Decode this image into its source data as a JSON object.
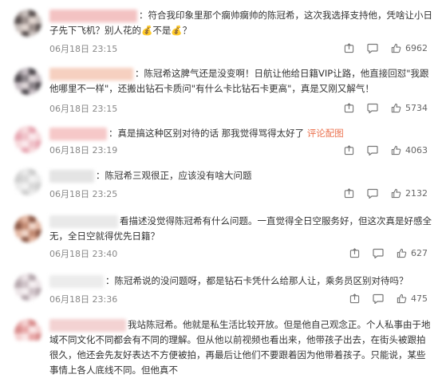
{
  "comments": [
    {
      "avatar_colors": [
        "#9b8f8c",
        "#c7bebb",
        "#5a5150",
        "#e2d6d0"
      ],
      "name_color": "#f3c2c2",
      "text": "：符合我印象里那个瘸帅瘸帅的陈冠希，这次我选择支持他，凭啥让小日子先下飞机？别人花的💰不是💰？",
      "date": "06月18日 23:15",
      "likes": "6962"
    },
    {
      "avatar_colors": [
        "#8a8388",
        "#c5bcc2",
        "#4f4a4f",
        "#ddd5d8"
      ],
      "name_color": "#f6d0c0",
      "text": "：陈冠希这脾气还是没变啊！日航让他给日籍VIP让路，他直接回怼\"我跟他哪里不一样\"，还搬出钻石卡质问\"有什么卡比钻石卡更高\"，真是又刚又解气！",
      "date": "06月18日 23:15",
      "likes": "5734"
    },
    {
      "avatar_colors": [
        "#f0c2c9",
        "#f7dadd",
        "#e8a9b4",
        "#fbe9ec"
      ],
      "name_color": "#f6c8c8",
      "text": "：真是搞这种区别对待的话 那我觉得骂得太好了",
      "link": "评论配图",
      "date": "06月18日 23:19",
      "likes": "4063"
    },
    {
      "avatar_colors": [
        "#d9d9d9",
        "#eaeaea",
        "#cfcfcf",
        "#f2f2f2"
      ],
      "name_color": "#e4e4e4",
      "text": "：陈冠希三观很正，应该没有啥大问题",
      "date": "06月18日 23:25",
      "likes": "2132"
    },
    {
      "avatar_colors": [
        "#c48c74",
        "#e3b7a3",
        "#8f5c4a",
        "#f0d5c8"
      ],
      "name_color": "#e9e9e9",
      "text": "看描述没觉得陈冠希有什么问题。一直觉得全日空服务好，但这次真是好感全无，全日空就得优先日籍？",
      "date": "06月18日 23:40",
      "likes": "627"
    },
    {
      "avatar_colors": [
        "#cfc3c8",
        "#ece4e7",
        "#b7a9af",
        "#f5eff1"
      ],
      "name_color": "#ececec",
      "text": "：陈冠希说的没问题呀，都是钻石卡凭什么给那人让，乘务员区别对待吗？",
      "date": "06月18日 23:36",
      "likes": "475"
    },
    {
      "avatar_colors": [
        "#e9a9a9",
        "#f4d0d0",
        "#d98e8e",
        "#fae6e6"
      ],
      "name_color": "#f3d2d2",
      "text": "我站陈冠希。他就是私生活比较开放。但是他自己观念正。个人私事由于地域不同文化不同都会有不同的理解。但从他以前视频也看出来，他带孩子出去，在街头被跟拍很久，他还会先友好表达不方便被拍，再最后让他们不要跟着因为他带着孩子。只能说，某些事情上各人底线不同。但他真不"
    }
  ]
}
